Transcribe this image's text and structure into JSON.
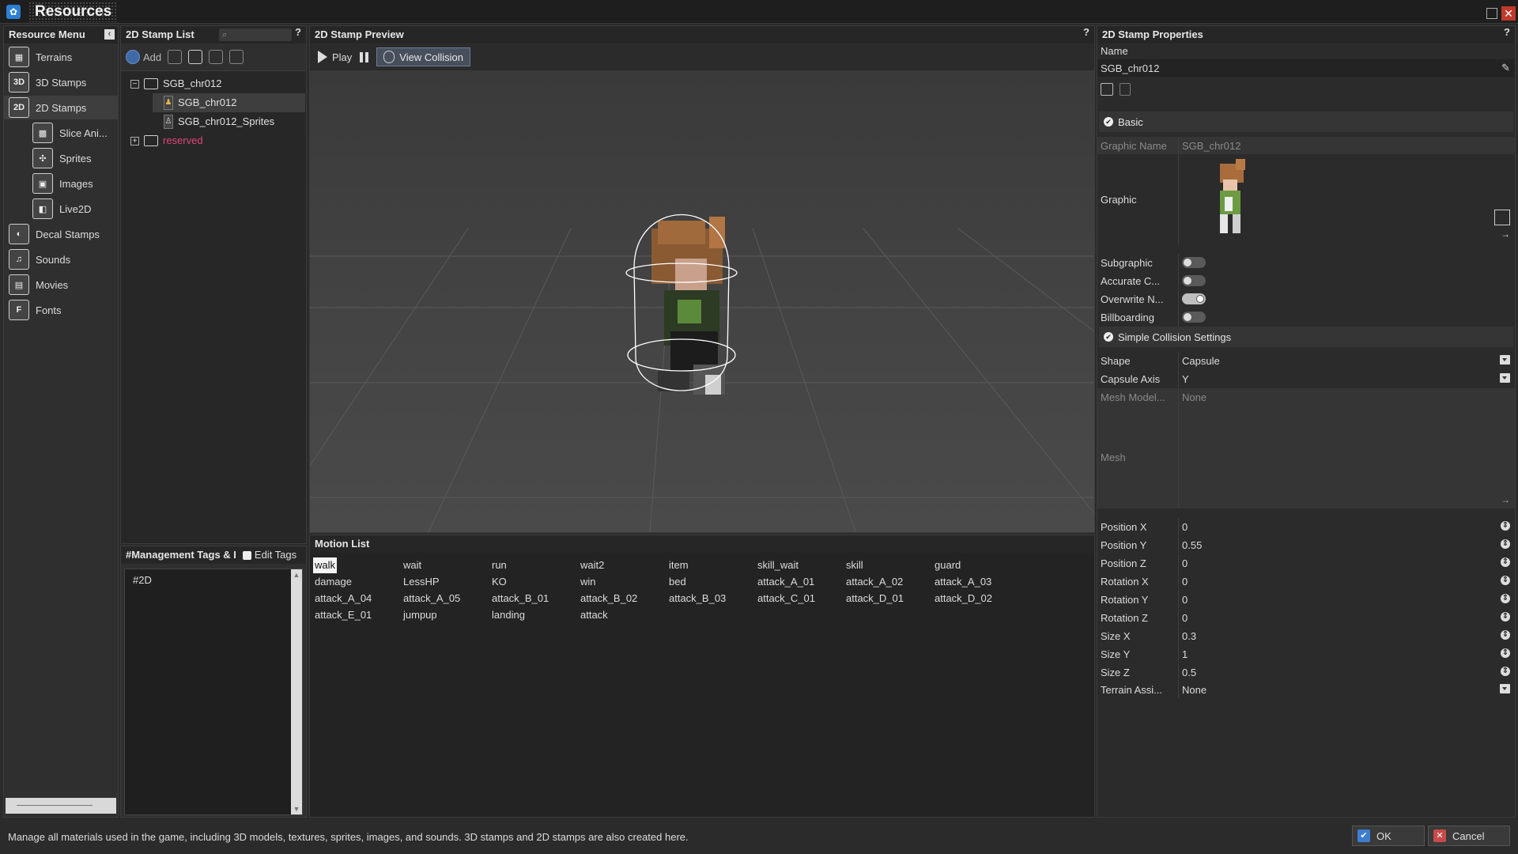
{
  "window": {
    "title": "Resources"
  },
  "resource_menu": {
    "title": "Resource Menu",
    "items": [
      {
        "label": "Terrains",
        "icon": "terrain-icon",
        "glyph": "▦"
      },
      {
        "label": "3D Stamps",
        "icon": "3d-stamp-icon",
        "glyph": "3D"
      },
      {
        "label": "2D Stamps",
        "icon": "2d-stamp-icon",
        "glyph": "2D"
      },
      {
        "label": "Slice Ani...",
        "icon": "slice-animation-icon",
        "glyph": "▩"
      },
      {
        "label": "Sprites",
        "icon": "sprites-icon",
        "glyph": "✣"
      },
      {
        "label": "Images",
        "icon": "images-icon",
        "glyph": "▣"
      },
      {
        "label": "Live2D",
        "icon": "live2d-icon",
        "glyph": "◧"
      },
      {
        "label": "Decal Stamps",
        "icon": "decal-stamp-icon",
        "glyph": "◐"
      },
      {
        "label": "Sounds",
        "icon": "sounds-icon",
        "glyph": "♫"
      },
      {
        "label": "Movies",
        "icon": "movies-icon",
        "glyph": "▤"
      },
      {
        "label": "Fonts",
        "icon": "fonts-icon",
        "glyph": "F"
      }
    ]
  },
  "stamp_list": {
    "title": "2D Stamp List",
    "help": "?",
    "toolbar": {
      "add_label": "Add"
    },
    "tree": [
      {
        "label": "SGB_chr012",
        "type": "folder"
      },
      {
        "label": "SGB_chr012",
        "type": "stamp"
      },
      {
        "label": "SGB_chr012_Sprites",
        "type": "sprite"
      },
      {
        "label": "reserved",
        "type": "folder"
      }
    ]
  },
  "tags": {
    "title": "#Management Tags & I",
    "edit_label": "Edit Tags",
    "items": [
      "#2D"
    ]
  },
  "preview": {
    "title": "2D Stamp Preview",
    "help": "?",
    "play_label": "Play",
    "view_collision_label": "View Collision"
  },
  "motion_list": {
    "title": "Motion List",
    "selected": "walk",
    "rows": [
      [
        "walk",
        "wait",
        "run",
        "wait2",
        "item",
        "skill_wait",
        "skill",
        "guard"
      ],
      [
        "damage",
        "LessHP",
        "KO",
        "win",
        "bed",
        "attack_A_01",
        "attack_A_02",
        "attack_A_03"
      ],
      [
        "attack_A_04",
        "attack_A_05",
        "attack_B_01",
        "attack_B_02",
        "attack_B_03",
        "attack_C_01",
        "attack_D_01",
        "attack_D_02"
      ],
      [
        "attack_E_01",
        "jumpup",
        "landing",
        "attack"
      ]
    ]
  },
  "properties": {
    "title": "2D Stamp Properties",
    "help": "?",
    "name_label": "Name",
    "name_value": "SGB_chr012",
    "basic": {
      "title": "Basic",
      "graphic_name_label": "Graphic Name",
      "graphic_name_value": "SGB_chr012",
      "graphic_label": "Graphic",
      "toggles": [
        {
          "label": "Subgraphic",
          "on": false
        },
        {
          "label": "Accurate C...",
          "on": false
        },
        {
          "label": "Overwrite N...",
          "on": true
        },
        {
          "label": "Billboarding",
          "on": false
        }
      ]
    },
    "collision": {
      "title": "Simple Collision Settings",
      "shape_label": "Shape",
      "shape_value": "Capsule",
      "axis_label": "Capsule Axis",
      "axis_value": "Y",
      "mesh_model_label": "Mesh Model...",
      "mesh_model_value": "None",
      "mesh_label": "Mesh",
      "fields": [
        {
          "label": "Position X",
          "value": "0"
        },
        {
          "label": "Position Y",
          "value": "0.55"
        },
        {
          "label": "Position Z",
          "value": "0"
        },
        {
          "label": "Rotation X",
          "value": "0"
        },
        {
          "label": "Rotation Y",
          "value": "0"
        },
        {
          "label": "Rotation Z",
          "value": "0"
        },
        {
          "label": "Size X",
          "value": "0.3"
        },
        {
          "label": "Size Y",
          "value": "1"
        },
        {
          "label": "Size Z",
          "value": "0.5"
        }
      ],
      "terrain_label": "Terrain Assi...",
      "terrain_value": "None"
    }
  },
  "status_bar": {
    "text": "Manage all materials used in the game, including 3D models, textures, sprites, images, and sounds. 3D stamps and 2D stamps are also created here."
  },
  "buttons": {
    "ok": "OK",
    "cancel": "Cancel"
  },
  "colors": {
    "accent": "#3d7ecf",
    "reserved": "#e0457b",
    "close": "#c0392b"
  }
}
